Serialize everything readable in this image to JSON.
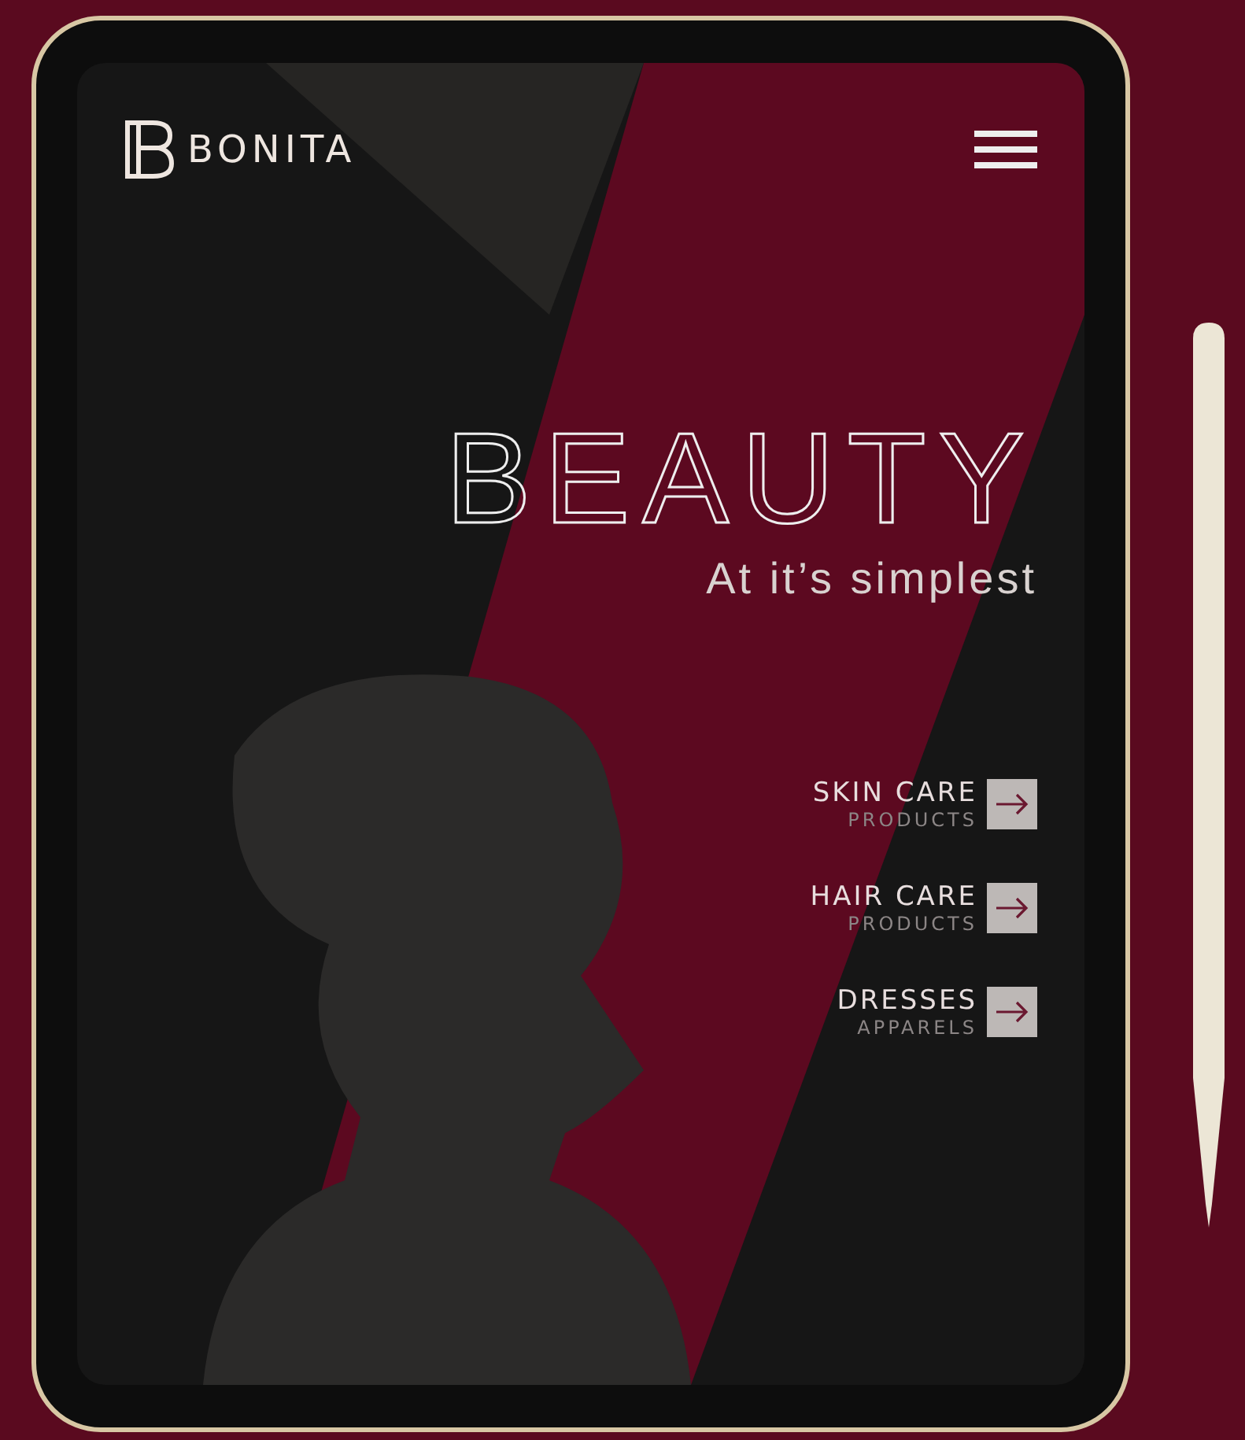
{
  "header": {
    "brand": "BONITA"
  },
  "hero": {
    "title": "BEAUTY",
    "subtitle": "At it’s simplest"
  },
  "categories": [
    {
      "title": "SKIN CARE",
      "subtitle": "PRODUCTS"
    },
    {
      "title": "HAIR CARE",
      "subtitle": "PRODUCTS"
    },
    {
      "title": "DRESSES",
      "subtitle": "APPARELS"
    }
  ]
}
